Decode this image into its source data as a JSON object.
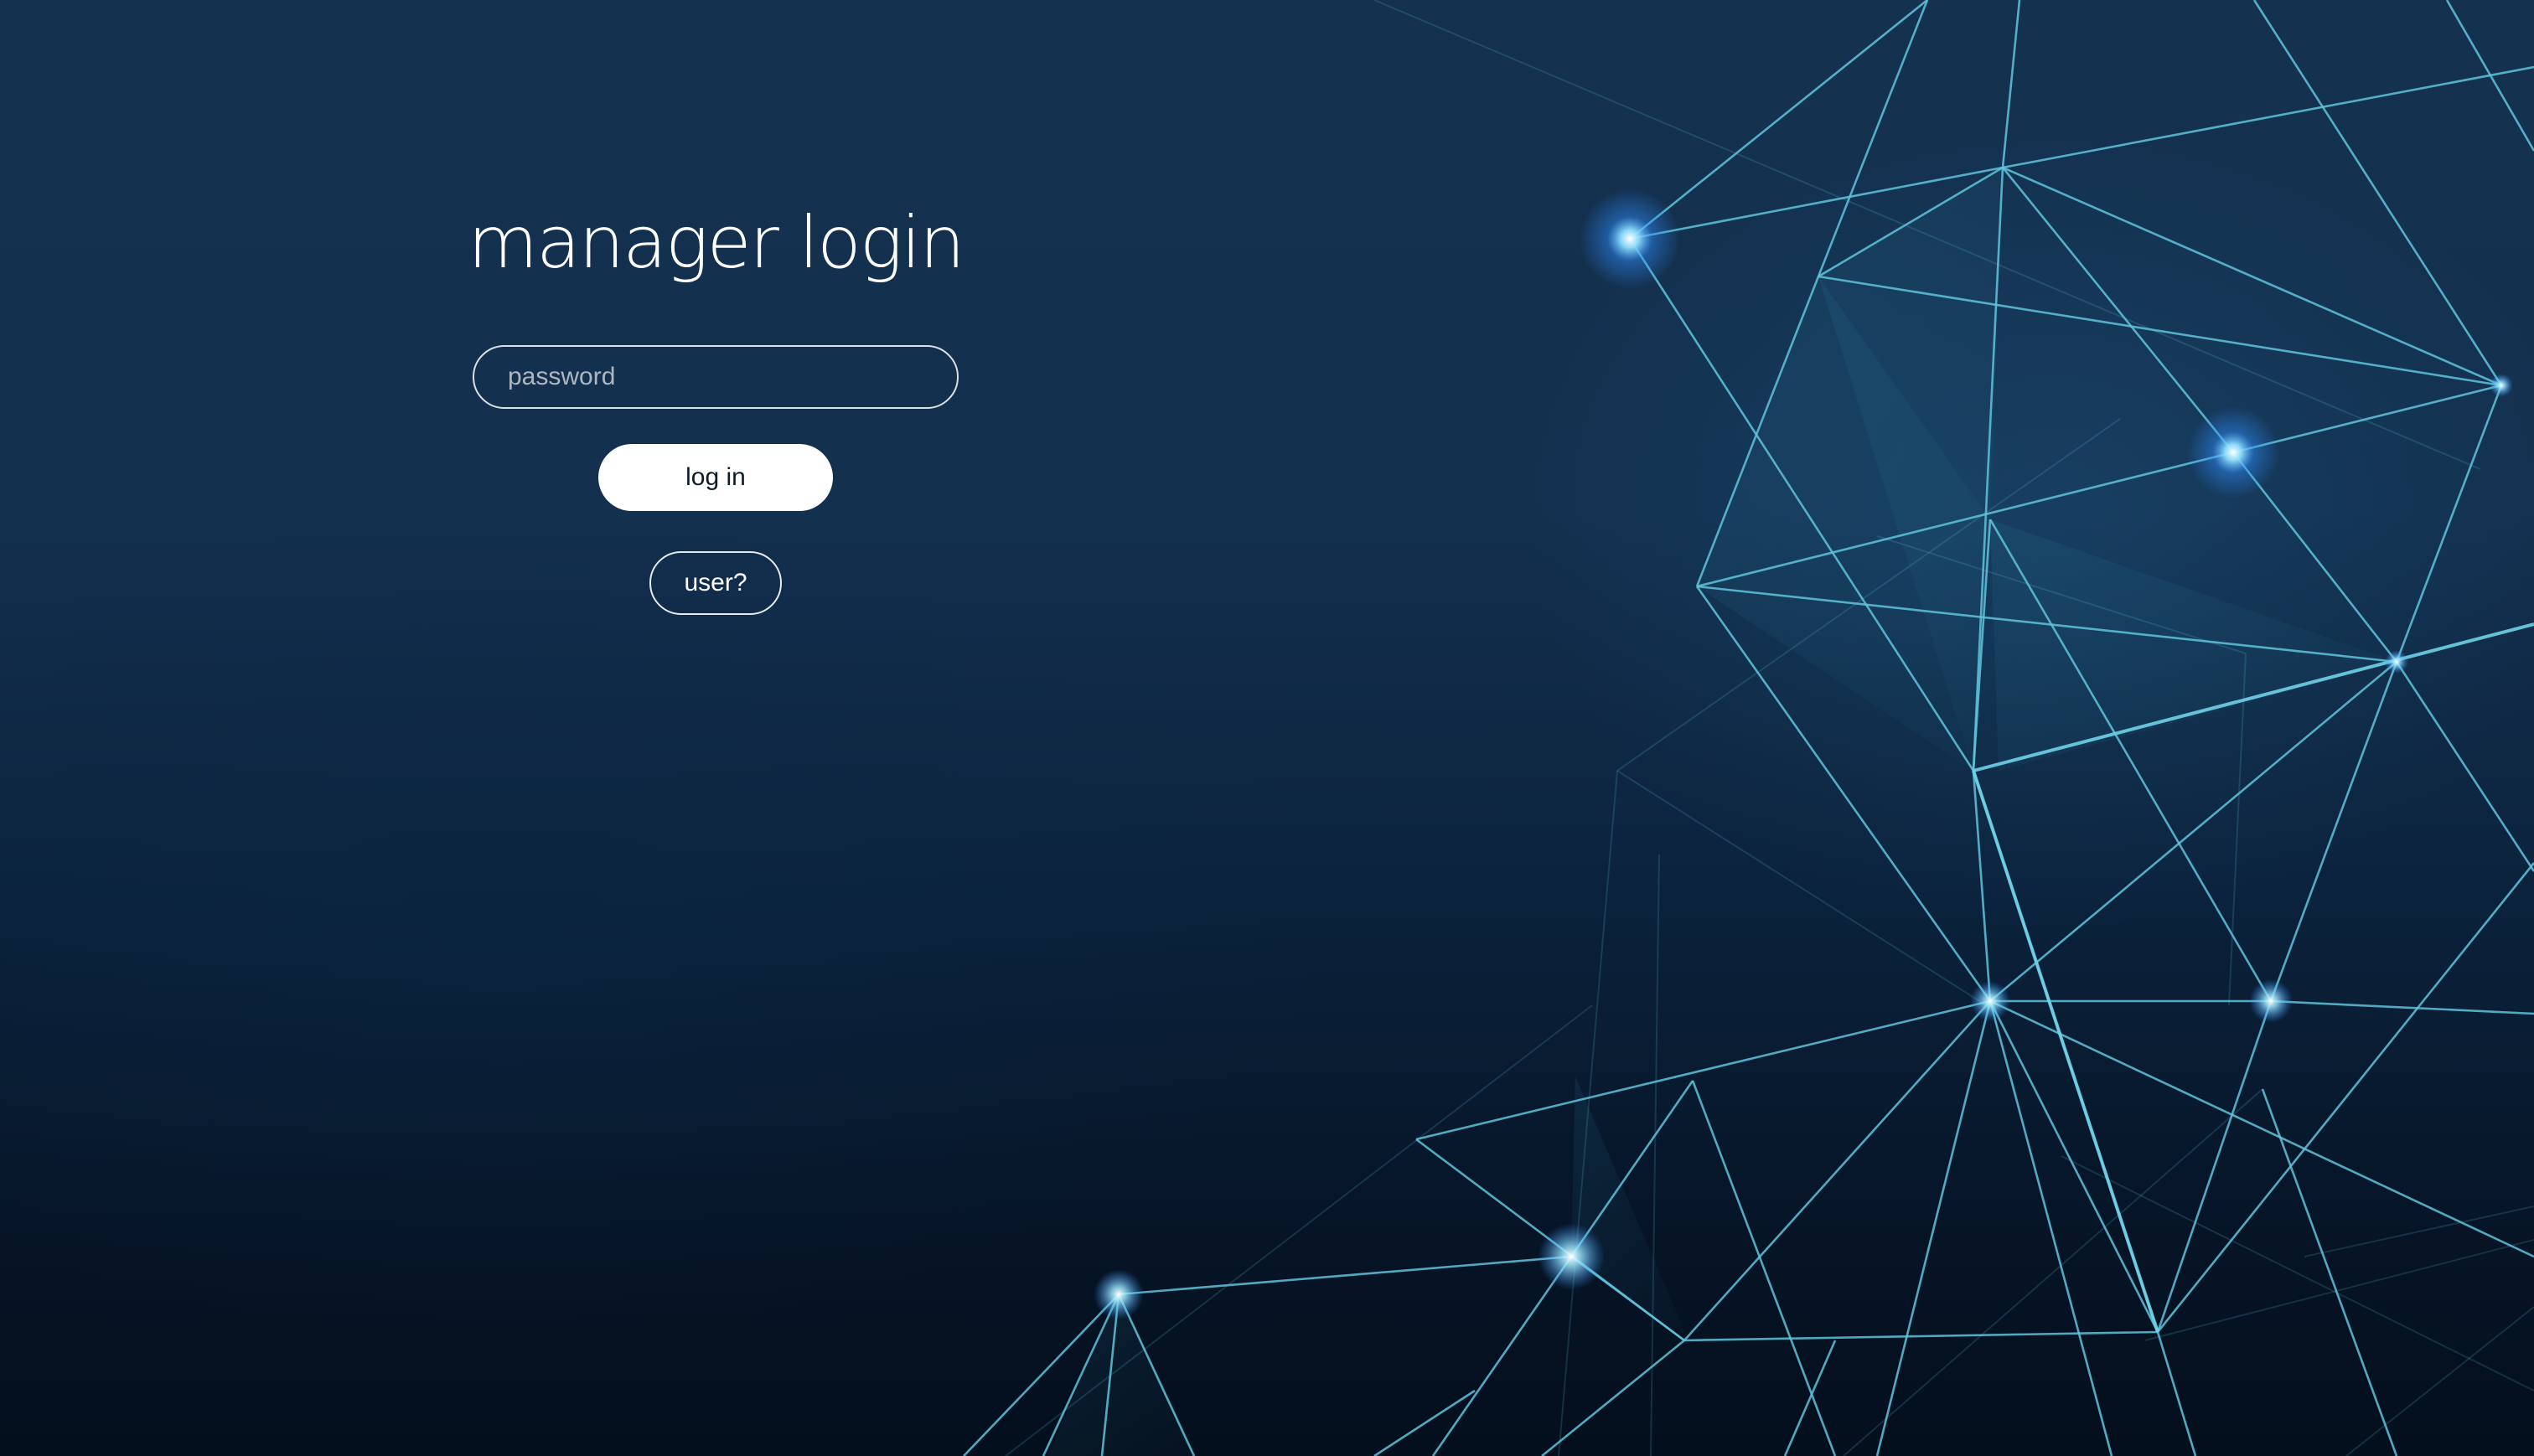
{
  "login": {
    "title": "manager login",
    "password_placeholder": "password",
    "login_label": "log in",
    "user_label": "user?"
  },
  "colors": {
    "background_top": "#14314f",
    "background_bottom": "#040f1d",
    "network_line": "#5fc4dc",
    "node_glow": "#3fa0ff",
    "button_fill": "#ffffff"
  }
}
